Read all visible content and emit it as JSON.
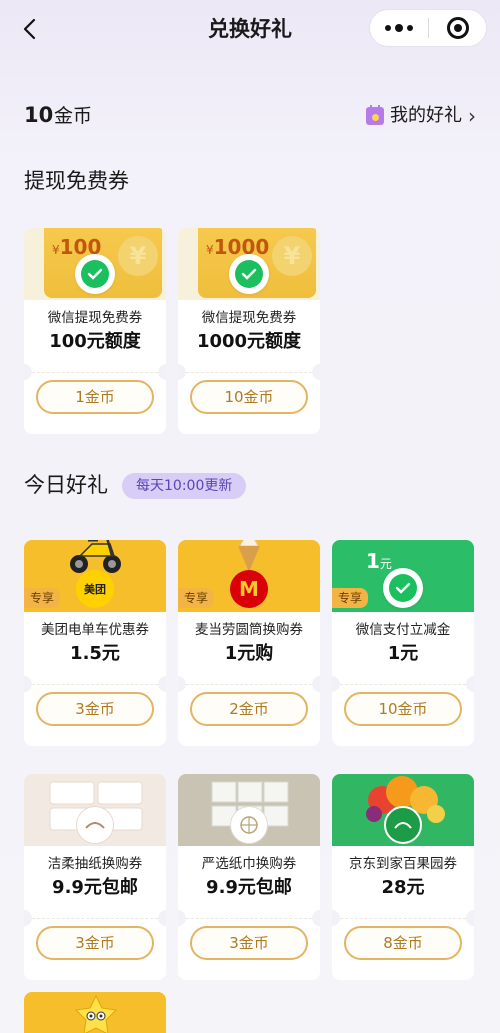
{
  "nav": {
    "title": "兑换好礼"
  },
  "coins": {
    "amount": "10",
    "unit": "金币"
  },
  "my_gifts": {
    "label": "我的好礼"
  },
  "withdraw": {
    "title": "提现免费券",
    "cards": [
      {
        "amount": "100",
        "name": "微信提现免费券",
        "value": "100元额度",
        "price": "1金币"
      },
      {
        "amount": "1000",
        "name": "微信提现免费券",
        "value": "1000元额度",
        "price": "10金币"
      }
    ]
  },
  "daily": {
    "title": "今日好礼",
    "badge": "每天10:00更新",
    "exclusive_tag": "专享",
    "cards": [
      {
        "brand": "美团",
        "name": "美团电单车优惠券",
        "value": "1.5元",
        "price": "3金币"
      },
      {
        "brand": "M",
        "name": "麦当劳圆筒换购券",
        "value": "1元购",
        "price": "2金币"
      },
      {
        "face": "1",
        "face_unit": "元",
        "name": "微信支付立减金",
        "value": "1元",
        "price": "10金币"
      },
      {
        "name": "洁柔抽纸换购券",
        "value": "9.9元包邮",
        "price": "3金币"
      },
      {
        "name": "严选纸巾换购券",
        "value": "9.9元包邮",
        "price": "3金币"
      },
      {
        "name": "京东到家百果园券",
        "value": "28元",
        "price": "8金币"
      }
    ]
  },
  "colors": {
    "gold": "#efbe3c",
    "wechat_green": "#1bbf5d",
    "meituan_yellow": "#ffd100",
    "mcd_red": "#d90007",
    "badge_purple": "#d7cdf7",
    "button_border": "#e2b463"
  },
  "currency_symbol": "¥"
}
